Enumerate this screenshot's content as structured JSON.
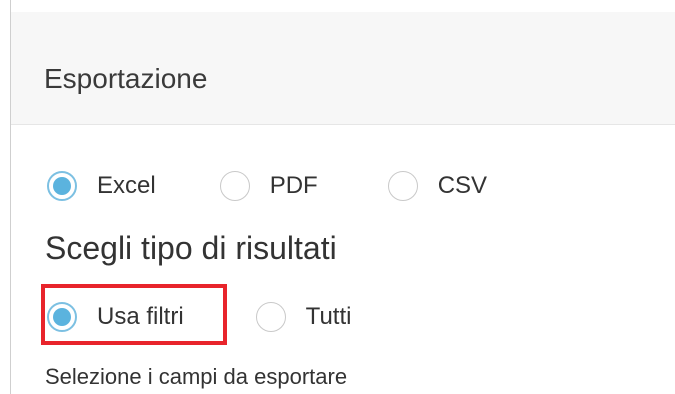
{
  "dialog": {
    "title": "Esportazione"
  },
  "format": {
    "options": [
      {
        "label": "Excel",
        "checked": true
      },
      {
        "label": "PDF",
        "checked": false
      },
      {
        "label": "CSV",
        "checked": false
      }
    ]
  },
  "results": {
    "title": "Scegli tipo di risultati",
    "options": [
      {
        "label": "Usa filtri",
        "checked": true
      },
      {
        "label": "Tutti",
        "checked": false
      }
    ]
  },
  "fields": {
    "label": "Selezione i campi da esportare"
  },
  "colors": {
    "accent": "#5bb3de",
    "highlight": "#e8242b",
    "header_bg": "#f7f7f7"
  }
}
